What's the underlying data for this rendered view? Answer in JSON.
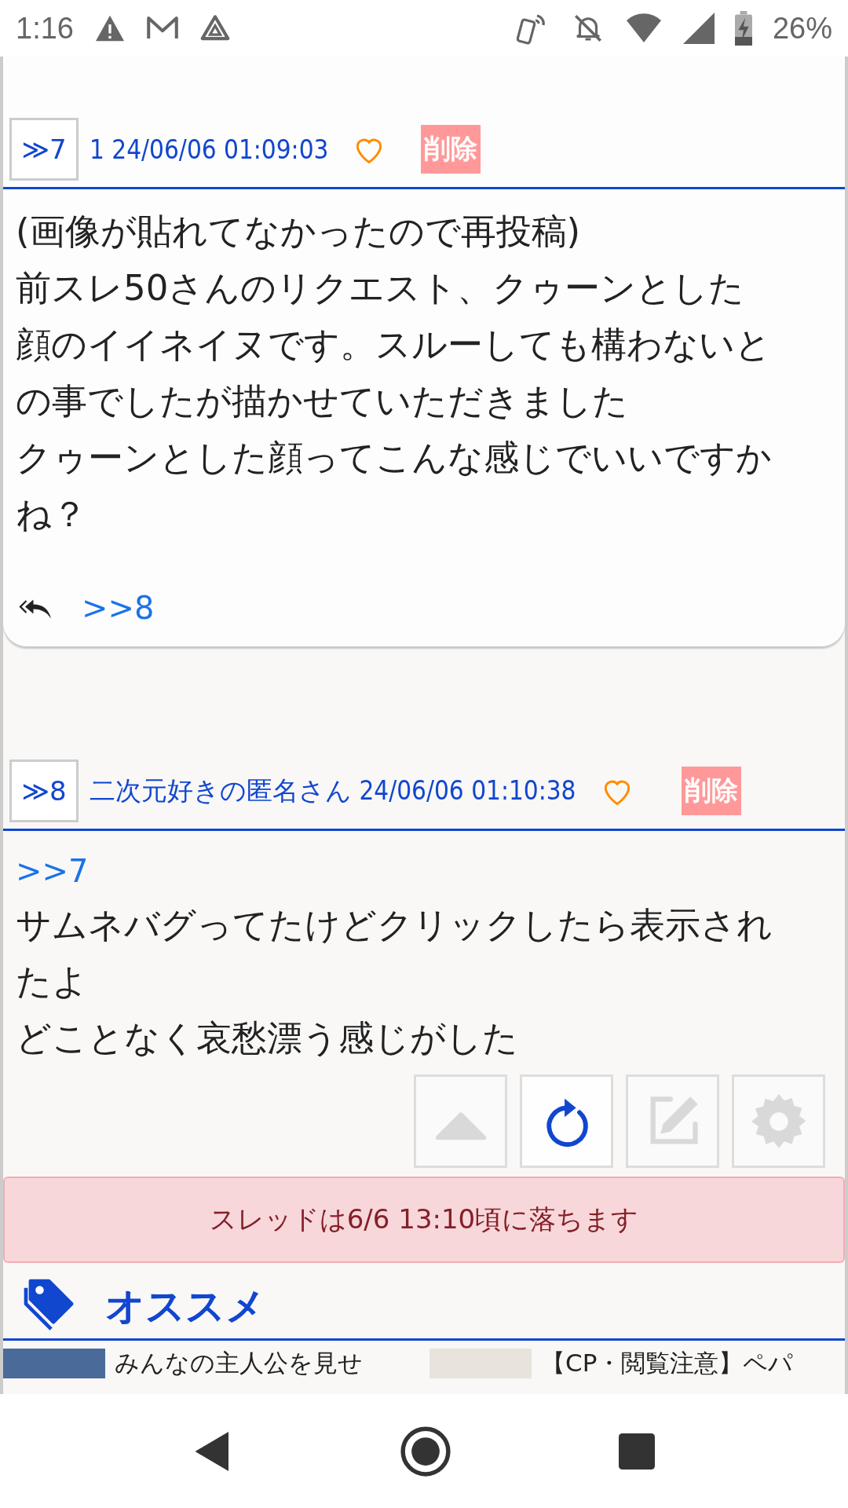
{
  "status_bar": {
    "time": "1:16",
    "battery": "26%"
  },
  "posts": [
    {
      "number": "≫7",
      "name": "1",
      "date": "24/06/06 01:09:03",
      "delete_label": "削除",
      "liked": false,
      "paragraphs": [
        "(画像が貼れてなかったので再投稿)",
        "前スレ50さんのリクエスト、クゥーンとした顔のイイネイヌです。スルーしても構わないとの事でしたが描かせていただきました",
        "クゥーンとした顔ってこんな感じでいいですかね？"
      ],
      "replies": [
        ">>8"
      ]
    },
    {
      "number": "≫8",
      "name": "二次元好きの匿名さん",
      "date": "24/06/06 01:10:38",
      "delete_label": "削除",
      "liked": false,
      "anchor": ">>7",
      "paragraphs": [
        "サムネバグってたけどクリックしたら表示されたよ",
        "どことなく哀愁漂う感じがした"
      ]
    }
  ],
  "toolbar": [
    {
      "kind": "top",
      "disabled": true
    },
    {
      "kind": "refresh",
      "disabled": false
    },
    {
      "kind": "edit",
      "disabled": true
    },
    {
      "kind": "settings",
      "disabled": true
    }
  ],
  "notice": "スレッドは6/6 13:10頃に落ちます",
  "recommend": {
    "title": "オススメ",
    "items": [
      {
        "title": "みんなの主人公を見せ"
      },
      {
        "title": "【CP・閲覧注意】ペパ"
      }
    ]
  }
}
